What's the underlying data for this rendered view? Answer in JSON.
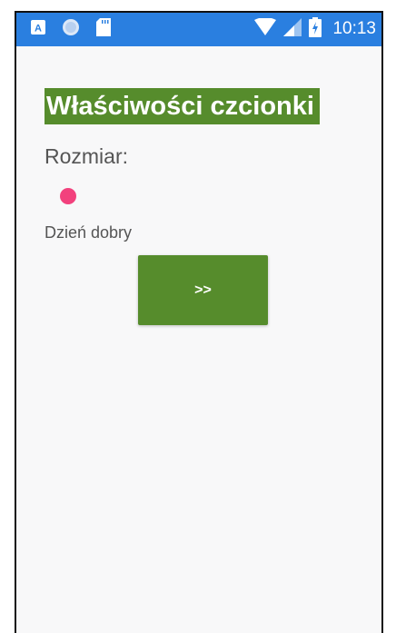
{
  "status_bar": {
    "time": "10:13",
    "icons": [
      "a-app-icon",
      "circle-app-icon",
      "sd-card-icon",
      "wifi-icon",
      "signal-icon",
      "battery-charging-icon"
    ],
    "color": "#2a7fe0"
  },
  "page": {
    "title": "Właściwości czcionki",
    "size_label": "Rozmiar:",
    "sample_text": "Dzień dobry",
    "next_button_label": ">>"
  },
  "slider": {
    "value": 0,
    "thumb_color": "#f2417d"
  },
  "colors": {
    "accent": "#568c2c",
    "background": "#f8f8f9"
  }
}
